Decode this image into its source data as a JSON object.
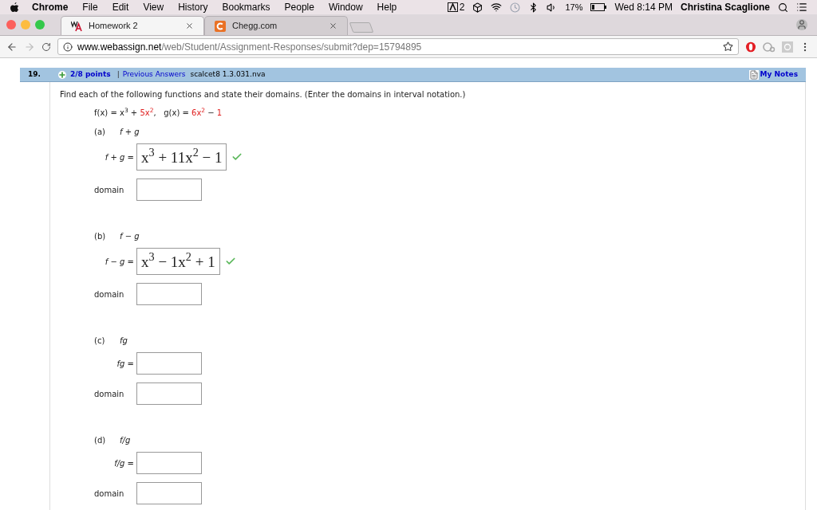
{
  "menubar": {
    "app": "Chrome",
    "items": [
      "File",
      "Edit",
      "View",
      "History",
      "Bookmarks",
      "People",
      "Window",
      "Help"
    ],
    "adobe_count": "2",
    "battery": "17%",
    "clock": "Wed 8:14 PM",
    "user": "Christina Scaglione"
  },
  "tabs": [
    {
      "title": "Homework 2",
      "selected": true,
      "kind": "webassign"
    },
    {
      "title": "Chegg.com",
      "selected": false,
      "kind": "chegg"
    }
  ],
  "address": {
    "host": "www.webassign.net",
    "path": "/web/Student/Assignment-Responses/submit?dep=15794895"
  },
  "question": {
    "number": "19.",
    "points": "2/8 points",
    "separator": "|",
    "previous": "Previous Answers",
    "code": "scalcet8 1.3.031.nva",
    "notes": "My Notes",
    "prompt": "Find each of the following functions and state their domains. (Enter the domains in interval notation.)",
    "formula": [
      {
        "text": "f(x) = x$^{3}$ + ",
        "kind": "plain"
      },
      {
        "text": "5x$^{2}$",
        "kind": "given"
      },
      {
        "text": ",   g(x) = ",
        "kind": "plain"
      },
      {
        "text": "6x$^{2}$",
        "kind": "given"
      },
      {
        "text": " − ",
        "kind": "plain"
      },
      {
        "text": "1",
        "kind": "given"
      }
    ],
    "parts": [
      {
        "letter": "(a)",
        "expr": "f + g",
        "answer_label": "f + g =",
        "answer": "x$^{3}$ + 11x$^{2}$ − 1",
        "correct": true,
        "domain_label": "domain"
      },
      {
        "letter": "(b)",
        "expr": "f − g",
        "answer_label": "f − g =",
        "answer": "x$^{3}$ − 1x$^{2}$ + 1",
        "correct": true,
        "domain_label": "domain"
      },
      {
        "letter": "(c)",
        "expr": "fg",
        "answer_label": "fg =",
        "correct": false,
        "domain_label": "domain"
      },
      {
        "letter": "(d)",
        "expr": "f/g",
        "answer_label": "f/g =",
        "correct": false,
        "domain_label": "domain"
      }
    ]
  }
}
